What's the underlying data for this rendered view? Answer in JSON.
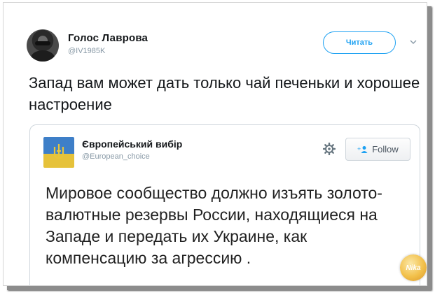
{
  "tweet": {
    "author_name": "Голос Лаврова",
    "author_handle": "@IV1985K",
    "follow_label": "Читать",
    "text": "Запад вам может дать только чай печеньки и хорошее настроение"
  },
  "quoted": {
    "author_name": "Європейський вибір",
    "author_handle": "@European_choice",
    "follow_label": "Follow",
    "text": "Мировое сообщество должно изъять золото-валютные резервы России, находящиеся на Западе и передать их Украине, как компенсацию за агрессию ."
  },
  "watermark": {
    "text": "Nika"
  },
  "icons": {
    "avatar": "user-avatar",
    "chevron": "chevron-down-icon",
    "gear": "gear-icon",
    "follow": "add-person-icon"
  },
  "colors": {
    "accent": "#1da1f2",
    "text": "#14171a",
    "muted": "#8899a6",
    "border": "#cfd6dc"
  }
}
